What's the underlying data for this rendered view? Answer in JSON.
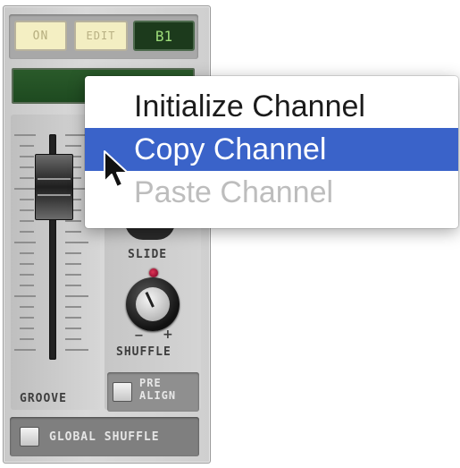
{
  "device": {
    "on_label": "ON",
    "edit_label": "EDIT",
    "pattern_display": "B1",
    "groove_label": "GROOVE",
    "slide_label": "SLIDE",
    "shuffle_label": "SHUFFLE",
    "shuffle_minus": "−",
    "shuffle_plus": "+",
    "prealign_line1": "PRE",
    "prealign_line2": "ALIGN",
    "global_shuffle_label": "GLOBAL SHUFFLE"
  },
  "context_menu": {
    "items": [
      {
        "label": "Initialize Channel",
        "state": "enabled"
      },
      {
        "label": "Copy Channel",
        "state": "highlighted"
      },
      {
        "label": "Paste Channel",
        "state": "disabled"
      }
    ]
  },
  "colors": {
    "menu_highlight": "#3a63c9",
    "lcd_green": "#2a5a2a",
    "pattern_text": "#9ddc7a"
  },
  "icons": {
    "cursor": "arrow-cursor-icon",
    "knob": "rotary-knob-icon"
  }
}
